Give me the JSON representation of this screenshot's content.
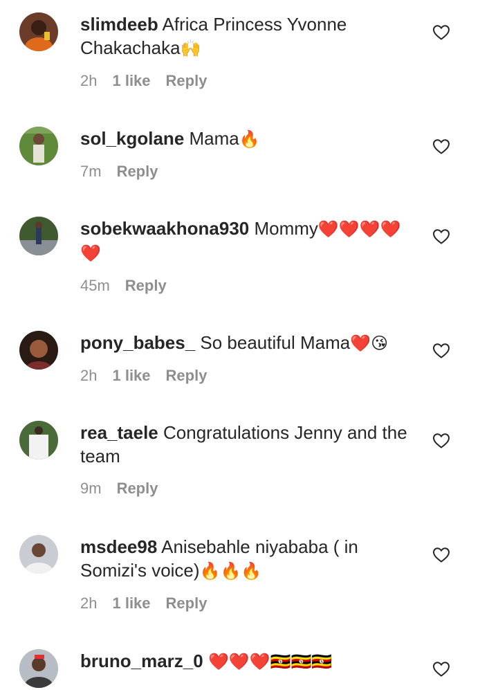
{
  "comments": [
    {
      "username": "slimdeeb",
      "text": "Africa Princess Yvonne Chakachaka",
      "emoji": "🙌",
      "time": "2h",
      "likes": "1 like",
      "reply": "Reply"
    },
    {
      "username": "sol_kgolane",
      "text": "Mama",
      "emoji": "🔥",
      "time": "7m",
      "likes": "",
      "reply": "Reply"
    },
    {
      "username": "sobekwaakhona930",
      "text": "Mommy",
      "emoji": "❤️❤️❤️❤️❤️",
      "time": "45m",
      "likes": "",
      "reply": "Reply"
    },
    {
      "username": "pony_babes_",
      "text": "So beautiful Mama",
      "emoji": "❤️😘",
      "time": "2h",
      "likes": "1 like",
      "reply": "Reply"
    },
    {
      "username": "rea_taele",
      "text": "Congratulations Jenny and the team",
      "emoji": "",
      "time": "9m",
      "likes": "",
      "reply": "Reply"
    },
    {
      "username": "msdee98",
      "text": "Anisebahle niyababa ( in Somizi's voice)",
      "emoji": "🔥🔥🔥",
      "time": "2h",
      "likes": "1 like",
      "reply": "Reply"
    },
    {
      "username": "bruno_marz_0",
      "text": "",
      "emoji": "❤️❤️❤️🇺🇬🇺🇬🇺🇬",
      "time": "",
      "likes": "",
      "reply": ""
    }
  ],
  "icons": {
    "like": "heart-outline-icon"
  },
  "colors": {
    "text": "#262626",
    "meta": "#8e8e8e"
  }
}
